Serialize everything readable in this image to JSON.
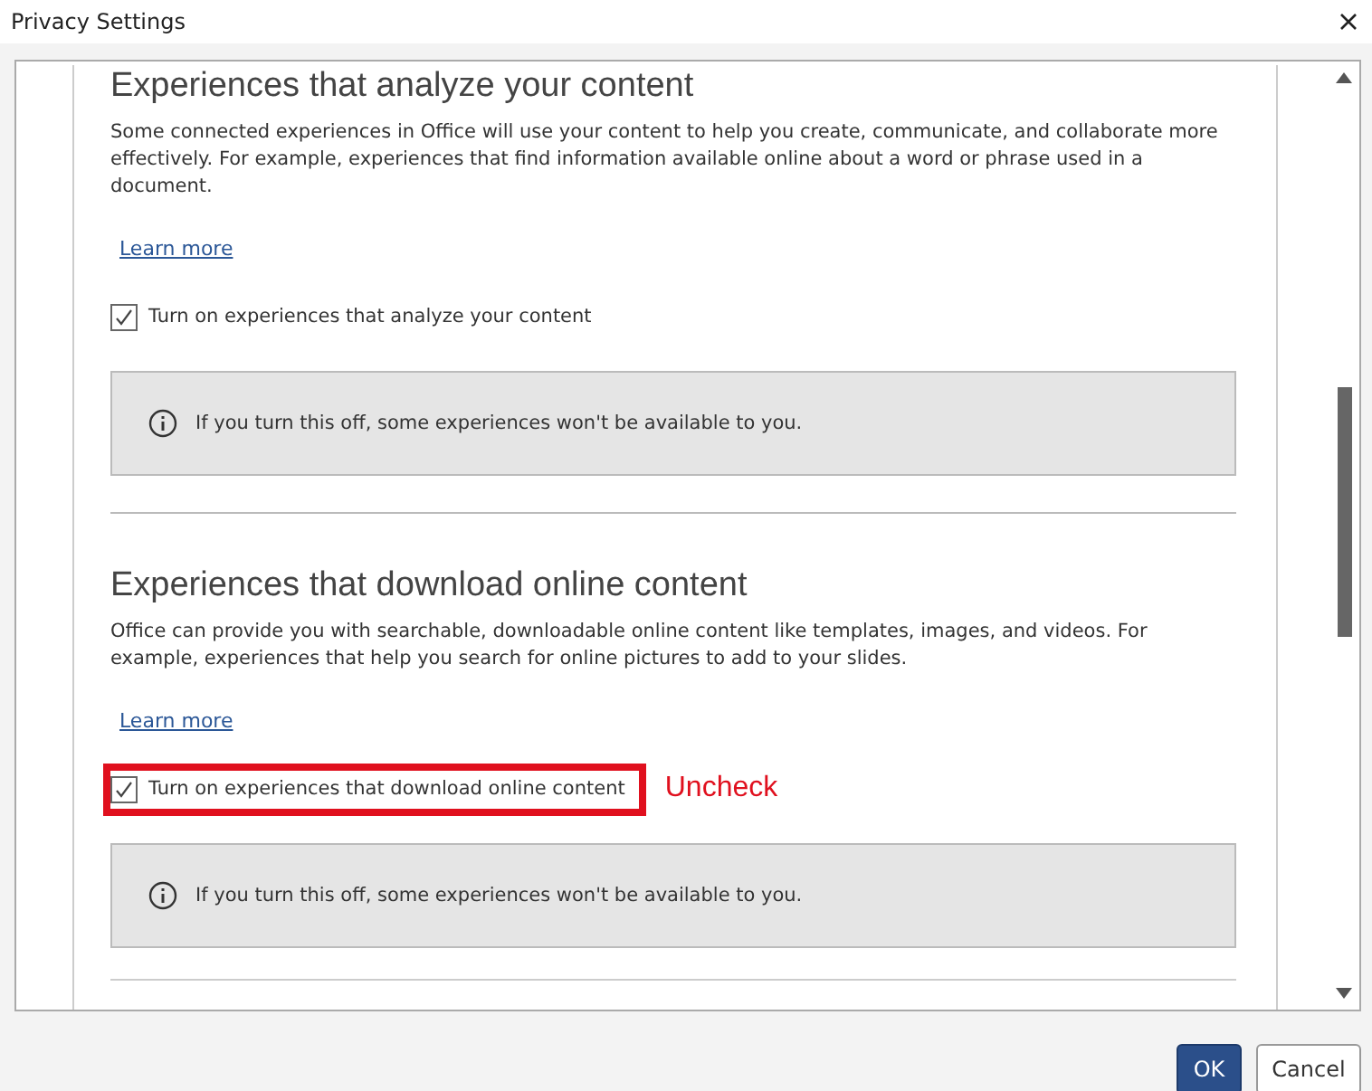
{
  "window": {
    "title": "Privacy Settings"
  },
  "sections": [
    {
      "heading": "Experiences that analyze your content",
      "description": "Some connected experiences in Office will use your content to help you create, communicate, and collaborate more effectively. For example, experiences that find information available online about a word or phrase used in a document.",
      "link": "Learn more",
      "checkbox": {
        "label": "Turn on experiences that analyze your content",
        "checked": true
      },
      "info": "If you turn this off, some experiences won't be available to you."
    },
    {
      "heading": "Experiences that download online content",
      "description": "Office can provide you with searchable, downloadable online content like templates, images, and videos. For example, experiences that help you search for online pictures to add to your slides.",
      "link": "Learn more",
      "checkbox": {
        "label": "Turn on experiences that download online content",
        "checked": true
      },
      "info": "If you turn this off, some experiences won't be available to you.",
      "annotation": "Uncheck"
    }
  ],
  "buttons": [
    {
      "label": "OK",
      "kind": "primary"
    },
    {
      "label": "Cancel",
      "kind": "secondary"
    }
  ]
}
